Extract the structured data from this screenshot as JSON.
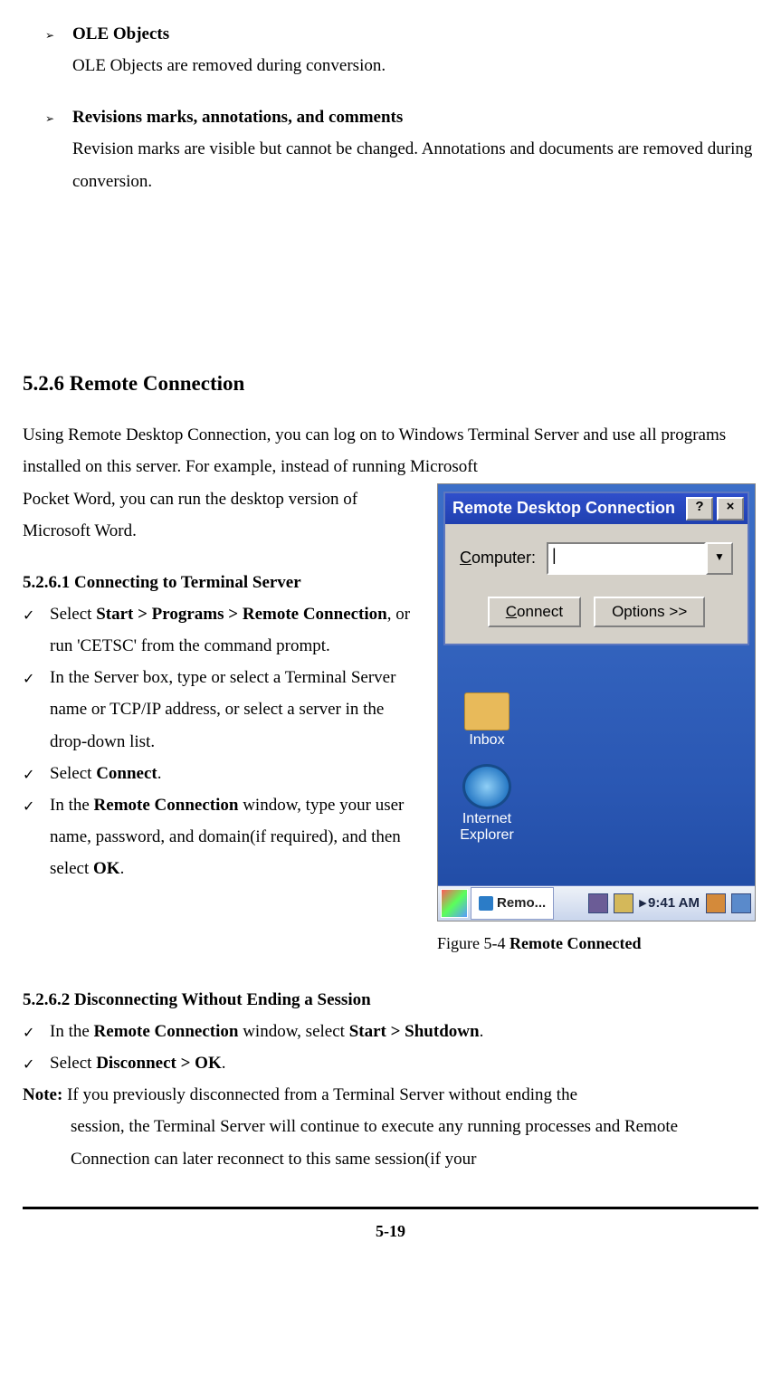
{
  "top_bullets": [
    {
      "title": "OLE Objects",
      "text": "OLE Objects are removed during conversion."
    },
    {
      "title": "Revisions marks, annotations, and comments",
      "text": "Revision marks are visible but cannot be changed. Annotations and documents are removed during conversion."
    }
  ],
  "section_heading": "5.2.6 Remote Connection",
  "intro_text_1": "Using Remote Desktop Connection, you can log on to Windows Terminal Server and use all programs installed on this server. For example, instead of running Microsoft ",
  "intro_text_2": "Pocket Word, you can run the desktop version of Microsoft Word.",
  "sub1_heading": "5.2.6.1 Connecting to Terminal Server",
  "sub1_items": {
    "i0": {
      "prefix": "Select ",
      "bold1": "Start > Programs > Remote Connection",
      "mid": ", or run 'CETSC' from the command prompt."
    },
    "i1": {
      "text": "In the Server box, type or select a Terminal Server name or TCP/IP address, or select a server in the drop-down list."
    },
    "i2": {
      "prefix": "Select ",
      "bold1": "Connect",
      "suffix": "."
    },
    "i3": {
      "prefix": "In the ",
      "bold1": "Remote Connection",
      "mid": " window, type your user name, password, and domain(if required), and then select ",
      "bold2": "OK",
      "suffix": "."
    }
  },
  "figure_caption": {
    "prefix": "Figure 5-4 ",
    "bold": "Remote Connected"
  },
  "sub2_heading": "5.2.6.2 Disconnecting Without Ending a Session",
  "sub2_items": {
    "i0": {
      "prefix": "In the ",
      "bold1": "Remote Connection",
      "mid": " window, select ",
      "bold2": "Start > Shutdown",
      "suffix": "."
    },
    "i1": {
      "prefix": "Select ",
      "bold1": "Disconnect > OK",
      "suffix": "."
    }
  },
  "note": {
    "label": "Note:",
    "line1": " If you previously disconnected from a Terminal Server without ending the",
    "body": "session, the Terminal Server will continue to execute any running processes and Remote Connection can later reconnect to this same session(if your "
  },
  "page_number": "5-19",
  "screenshot": {
    "window_title": "Remote Desktop Connection",
    "help_btn": "?",
    "close_btn": "×",
    "computer_label": "Computer:",
    "computer_value": "|",
    "combo_arrow": "▼",
    "connect_btn": "Connect",
    "options_btn": "Options >>",
    "desk_icon_inbox": "Inbox",
    "desk_icon_ie": "Internet Explorer",
    "task_label": "Remo...",
    "tray_arrow": "▸",
    "clock": "9:41 AM"
  }
}
